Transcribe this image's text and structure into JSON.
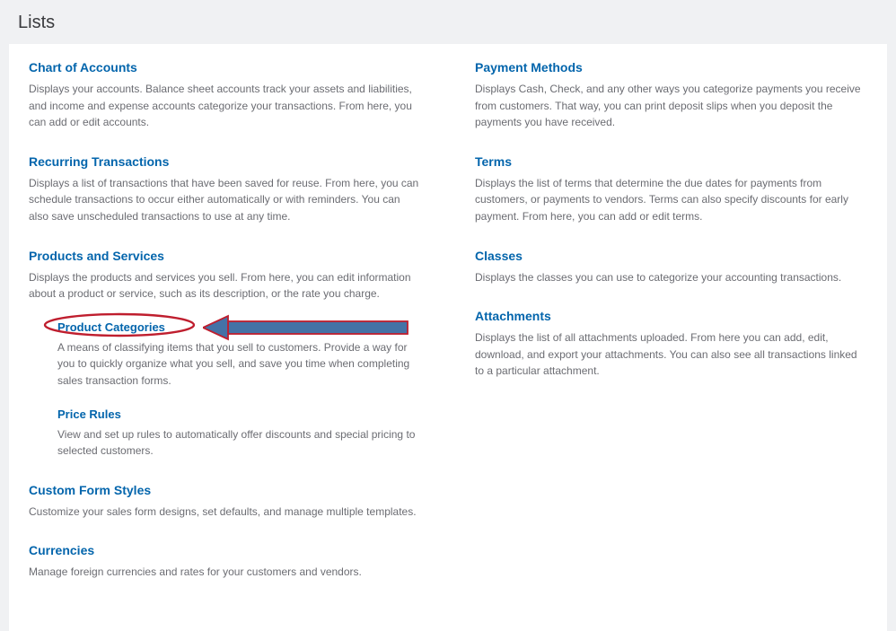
{
  "page": {
    "title": "Lists"
  },
  "left": [
    {
      "title": "Chart of Accounts",
      "desc": "Displays your accounts. Balance sheet accounts track your assets and liabilities, and income and expense accounts categorize your transactions. From here, you can add or edit accounts."
    },
    {
      "title": "Recurring Transactions",
      "desc": "Displays a list of transactions that have been saved for reuse. From here, you can schedule transactions to occur either automatically or with reminders. You can also save unscheduled transactions to use at any time."
    },
    {
      "title": "Products and Services",
      "desc": "Displays the products and services you sell. From here, you can edit information about a product or service, such as its description, or the rate you charge.",
      "subs": [
        {
          "title": "Product Categories",
          "desc": "A means of classifying items that you sell to customers. Provide a way for you to quickly organize what you sell, and save you time when completing sales transaction forms.",
          "highlight": true
        },
        {
          "title": "Price Rules",
          "desc": "View and set up rules to automatically offer discounts and special pricing to selected customers."
        }
      ]
    },
    {
      "title": "Custom Form Styles",
      "desc": "Customize your sales form designs, set defaults, and manage multiple templates."
    },
    {
      "title": "Currencies",
      "desc": "Manage foreign currencies and rates for your customers and vendors."
    }
  ],
  "right": [
    {
      "title": "Payment Methods",
      "desc": "Displays Cash, Check, and any other ways you categorize payments you receive from customers. That way, you can print deposit slips when you deposit the payments you have received."
    },
    {
      "title": "Terms",
      "desc": "Displays the list of terms that determine the due dates for payments from customers, or payments to vendors. Terms can also specify discounts for early payment. From here, you can add or edit terms."
    },
    {
      "title": "Classes",
      "desc": "Displays the classes you can use to categorize your accounting transactions."
    },
    {
      "title": "Attachments",
      "desc": "Displays the list of all attachments uploaded. From here you can add, edit, download, and export your attachments. You can also see all transactions linked to a particular attachment."
    }
  ]
}
